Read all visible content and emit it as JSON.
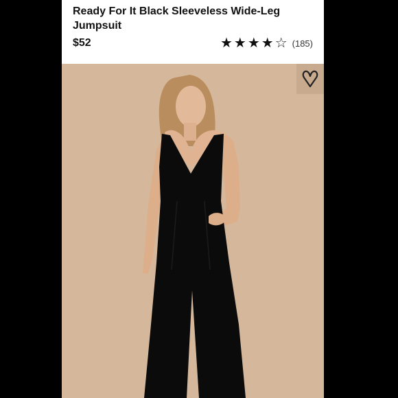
{
  "product": {
    "title": "Ready For It Black Sleeveless Wide-Leg Jumpsuit",
    "price": "$52",
    "rating": {
      "stars_filled": 4,
      "stars_total": 5,
      "review_count": "(185)"
    }
  },
  "icons": {
    "star_filled": "★",
    "star_empty": "☆",
    "favorite": "heart-icon"
  },
  "colors": {
    "backdrop": "#d5b89b",
    "garment": "#0b0b0b"
  }
}
